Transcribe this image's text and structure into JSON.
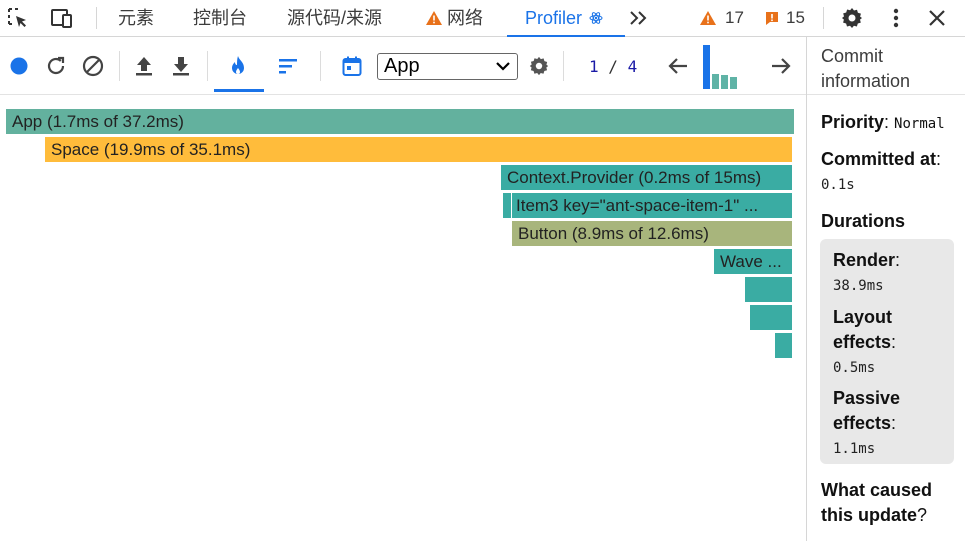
{
  "tabs": {
    "elements": "元素",
    "console": "控制台",
    "sources": "源代码/来源",
    "network": "网络",
    "profiler": "Profiler",
    "more_icon": "chevron-double-right-icon"
  },
  "status": {
    "warnings": "17",
    "errors": "15"
  },
  "toolbar": {
    "root_selected": "App",
    "commit_current": "1",
    "commit_separator": "/",
    "commit_total": "4",
    "commit_levels": [
      1.0,
      0.35,
      0.32,
      0.28
    ]
  },
  "flamegraph": {
    "app": "App (1.7ms of 37.2ms)",
    "space": "Space (19.9ms of 35.1ms)",
    "context_provider": "Context.Provider (0.2ms of 15ms)",
    "item3": "Item3 key=\"ant-space-item-1\" ...",
    "button": "Button (8.9ms of 12.6ms)",
    "wave": "Wave ..."
  },
  "sidebar": {
    "title": "Commit information",
    "priority_label": "Priority",
    "priority_value": "Normal",
    "committed_label": "Committed at",
    "committed_value": "0.1s",
    "durations_label": "Durations",
    "render_label": "Render",
    "render_value": "38.9ms",
    "layout_label_1": "Layout",
    "layout_label_2": "effects",
    "layout_value": "0.5ms",
    "passive_label_1": "Passive",
    "passive_label_2": "effects",
    "passive_value": "1.1ms",
    "cause_label_1": "What caused",
    "cause_label_2": "this update"
  },
  "colors": {
    "accent": "#1a73e8",
    "teal": "#63b19e",
    "orange": "#ffbc3b",
    "dark_teal": "#3aaca3",
    "olive": "#a8b57c",
    "warning": "#e8711a",
    "error": "#e8711a"
  }
}
